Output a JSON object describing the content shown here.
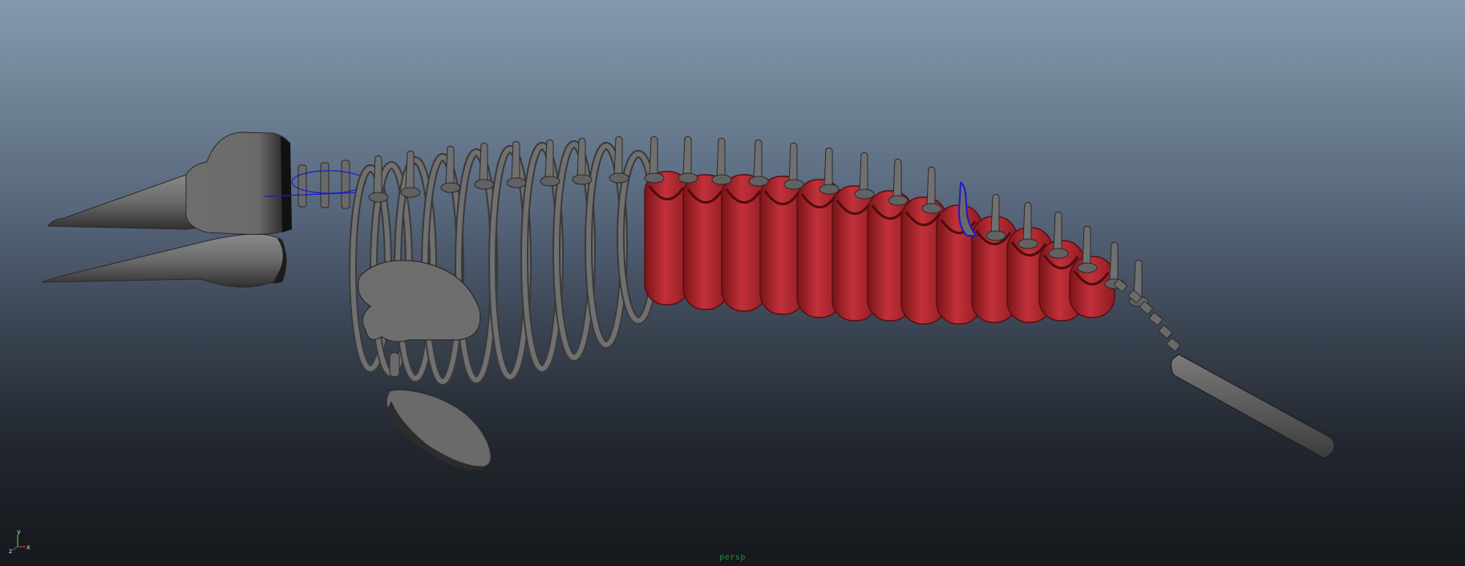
{
  "viewport": {
    "camera_name": "persp",
    "background_top": "#8598ae",
    "background_bottom": "#15181c"
  },
  "axes": {
    "x": "x",
    "y": "y",
    "z": "z"
  },
  "colors": {
    "bone": "#6b6b6b",
    "bone_dark": "#3a3a3a",
    "bone_light": "#8c8c8c",
    "selected_ribs": "#b52a30",
    "selected_ribs_dark": "#6d1216",
    "selection_wire": "#1a1ad0",
    "camera_label": "#2f8a3f"
  },
  "scene": {
    "model": "whale-skeleton",
    "parts": [
      "skull",
      "upper-jaw",
      "lower-jaw",
      "ribs",
      "spine-vertebrae",
      "scapula",
      "flipper",
      "tail-fluke"
    ]
  }
}
